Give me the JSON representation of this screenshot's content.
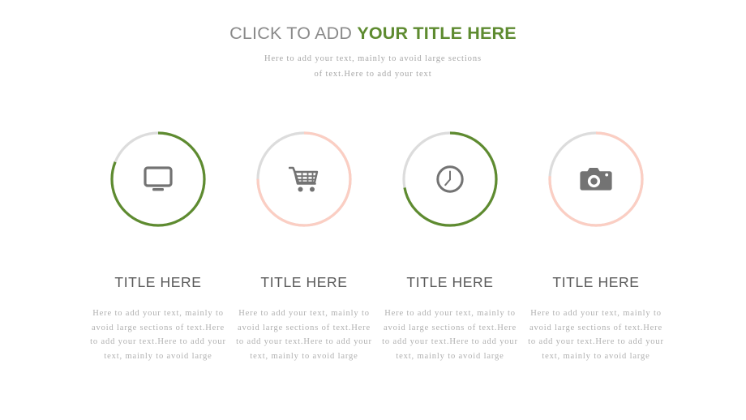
{
  "header": {
    "title_light": "CLICK TO ADD ",
    "title_accent": "YOUR TITLE HERE",
    "subtitle_line1": "Here to add your text, mainly to avoid large sections",
    "subtitle_line2": "of text.Here to add your text"
  },
  "colors": {
    "green": "#5e8b30",
    "pink": "#fbcec3",
    "track": "#dcdcdc",
    "icon": "#737373",
    "title_gray": "#8a8a8a",
    "body_gray": "#b0b0b0",
    "heading_gray": "#5a5a5a"
  },
  "columns": [
    {
      "icon": "monitor-icon",
      "ring_color": "#5e8b30",
      "track_color": "#dcdcdc",
      "progress_percent": 81,
      "title": "TITLE HERE",
      "body": "Here to add your text, mainly to avoid large sections of text.Here to add your text.Here to add your text, mainly to avoid large"
    },
    {
      "icon": "shopping-cart-icon",
      "ring_color": "#fbcec3",
      "track_color": "#dcdcdc",
      "progress_percent": 75,
      "title": "TITLE HERE",
      "body": "Here to add your text, mainly to avoid large sections of text.Here to add your text.Here to add your text, mainly to avoid large"
    },
    {
      "icon": "clock-icon",
      "ring_color": "#5e8b30",
      "track_color": "#dcdcdc",
      "progress_percent": 72,
      "title": "TITLE HERE",
      "body": "Here to add your text, mainly to avoid large sections of text.Here to add your text.Here to add your text, mainly to avoid large"
    },
    {
      "icon": "camera-icon",
      "ring_color": "#fbcec3",
      "track_color": "#dcdcdc",
      "progress_percent": 76,
      "title": "TITLE HERE",
      "body": "Here to add your text, mainly to avoid large sections of text.Here to add your text.Here to add your text, mainly to avoid large"
    }
  ]
}
